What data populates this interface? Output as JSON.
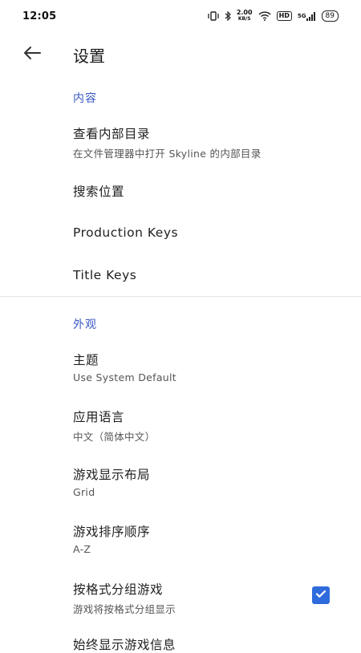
{
  "status_bar": {
    "time": "12:05",
    "speed_value": "2.00",
    "speed_unit": "KB/S",
    "hd_label": "HD",
    "signal_label": "5G",
    "battery": "89"
  },
  "app_bar": {
    "back_icon": "arrow-left-icon",
    "title": "设置"
  },
  "sections": [
    {
      "header": "内容",
      "items": [
        {
          "title": "查看内部目录",
          "subtitle": "在文件管理器中打开 Skyline 的内部目录"
        },
        {
          "title": "搜索位置"
        },
        {
          "title": "Production Keys"
        },
        {
          "title": "Title Keys"
        }
      ]
    },
    {
      "header": "外观",
      "items": [
        {
          "title": "主题",
          "subtitle": "Use System Default"
        },
        {
          "title": "应用语言",
          "subtitle": "中文（简体中文）"
        },
        {
          "title": "游戏显示布局",
          "subtitle": "Grid"
        },
        {
          "title": "游戏排序顺序",
          "subtitle": "A-Z"
        },
        {
          "title": "按格式分组游戏",
          "subtitle": "游戏将按格式分组显示",
          "checked": true
        },
        {
          "title": "始终显示游戏信息"
        }
      ]
    }
  ],
  "colors": {
    "accent": "#2f6bdc",
    "section_header": "#3a57c4"
  }
}
